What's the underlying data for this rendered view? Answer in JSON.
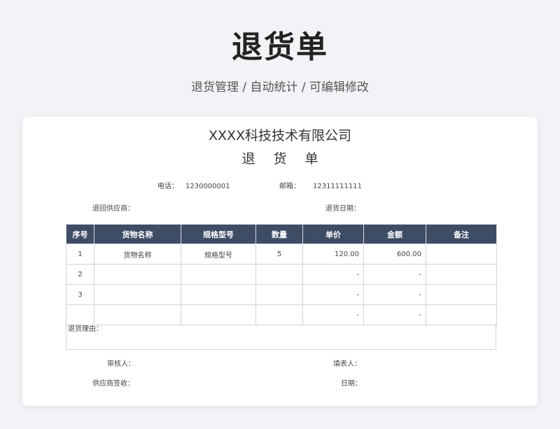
{
  "hero": {
    "title": "退货单",
    "subtitle": "退货管理 / 自动统计 /  可编辑修改"
  },
  "doc": {
    "company": "XXXX科技技术有限公司",
    "title": "退货单",
    "phone_label": "电话：",
    "phone": "1230000001",
    "email_label": "邮箱：",
    "email": "12311111111",
    "supplier_label": "退回供应商：",
    "return_date_label": "退货日期："
  },
  "table": {
    "headers": [
      "序号",
      "货物名称",
      "规格型号",
      "数量",
      "单价",
      "金额",
      "备注"
    ],
    "rows": [
      [
        "1",
        "货物名称",
        "规格型号",
        "5",
        "120.00",
        "600.00",
        ""
      ],
      [
        "2",
        "",
        "",
        "",
        "-",
        "-",
        ""
      ],
      [
        "3",
        "",
        "",
        "",
        "-",
        "-",
        ""
      ],
      [
        "",
        "",
        "",
        "",
        "-",
        "-",
        ""
      ]
    ]
  },
  "reason_label": "退货理由：",
  "footer": {
    "reviewer_label": "审核人：",
    "filler_label": "填表人：",
    "supplier_sign_label": "供应商签收：",
    "date_label": "日期："
  }
}
